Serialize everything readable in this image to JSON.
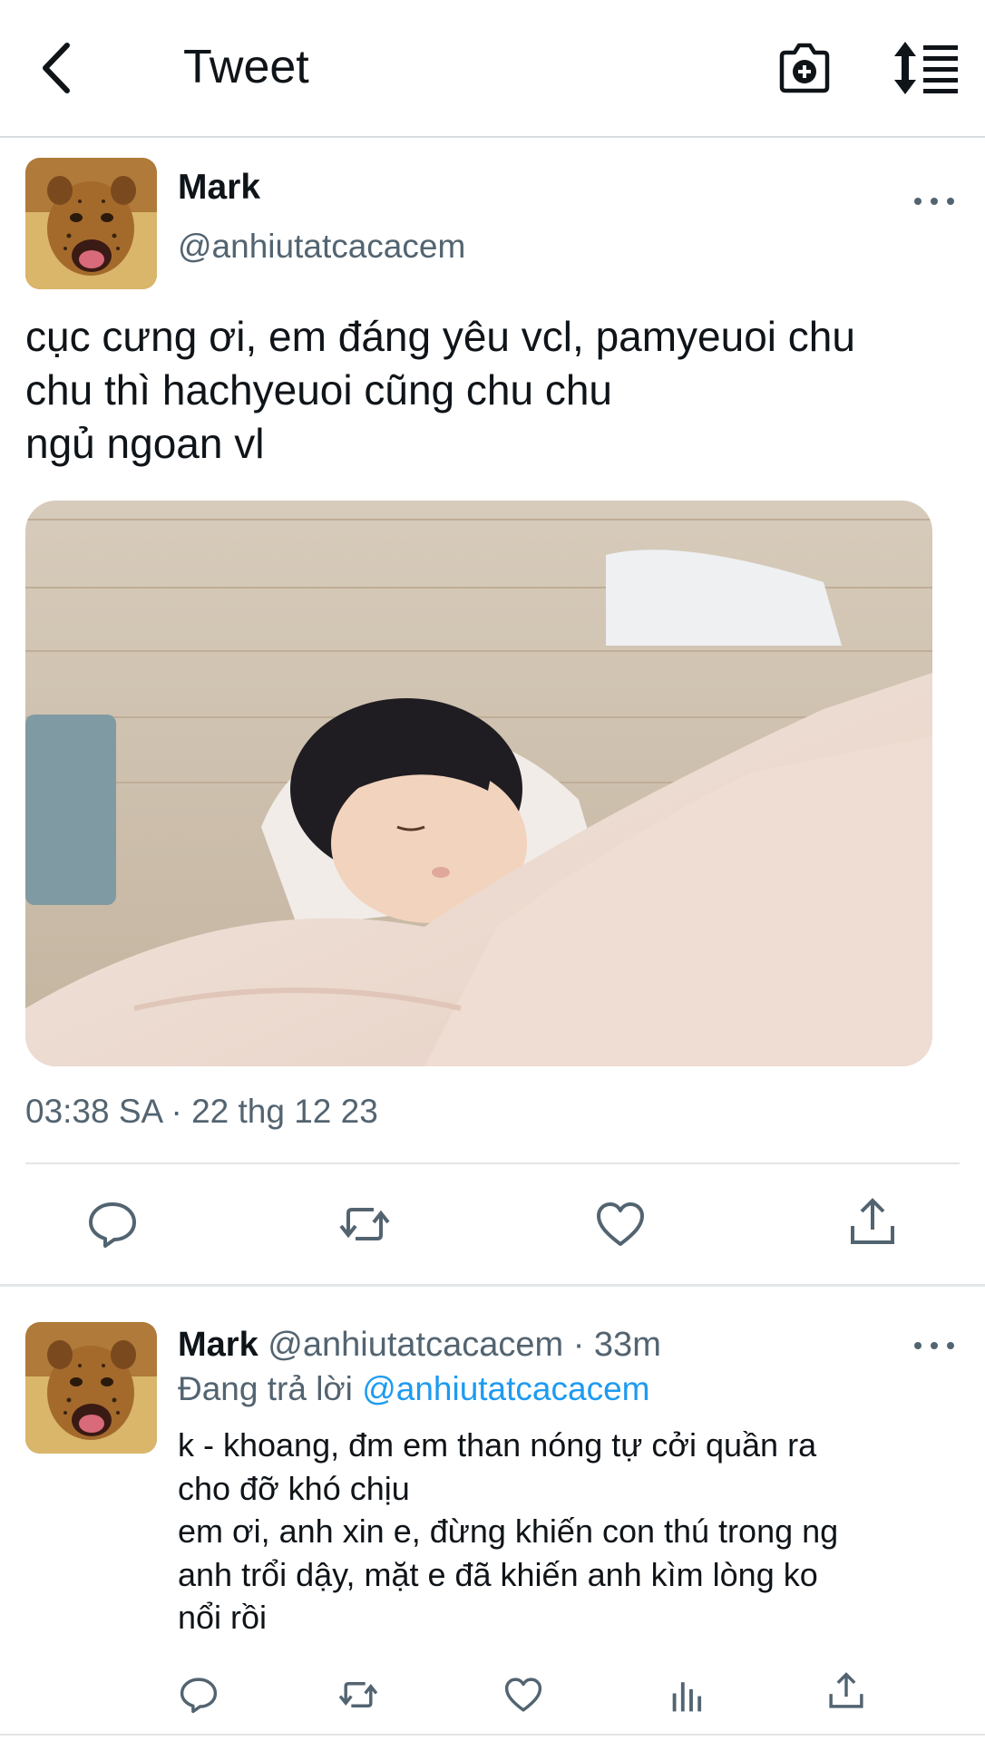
{
  "header": {
    "title": "Tweet",
    "back_icon": "back-arrow-icon",
    "camera_icon": "camera-add-icon",
    "sort_icon": "sort-list-icon"
  },
  "main_tweet": {
    "name": "Mark",
    "handle": "@anhiutatcacacem",
    "text": "cục cưng ơi, em đáng yêu vcl, pamyeuoi chu\nchu thì hachyeuoi cũng chu chu\nngủ ngoan vl",
    "timestamp": "03:38 SA · 22 thg 12 23",
    "actions": [
      "reply-icon",
      "retweet-icon",
      "like-icon",
      "share-icon"
    ]
  },
  "reply": {
    "name": "Mark",
    "handle": "@anhiutatcacacem",
    "separator": " · ",
    "time": "33m",
    "replying_prefix": "Đang trả lời ",
    "replying_to": "@anhiutatcacacem",
    "text": "k - khoang, đm em than nóng tự cởi quần ra\ncho đỡ khó chịu\nem ơi, anh xin e, đừng khiến con thú trong ng\nanh trổi dậy, mặt e đã khiến anh kìm lòng ko\nnổi rồi",
    "actions": [
      "reply-icon",
      "retweet-icon",
      "like-icon",
      "analytics-icon",
      "share-icon"
    ]
  },
  "colors": {
    "text": "#0f1419",
    "secondary": "#536471",
    "link": "#1d9bf0",
    "divider": "#e3e6e8"
  }
}
